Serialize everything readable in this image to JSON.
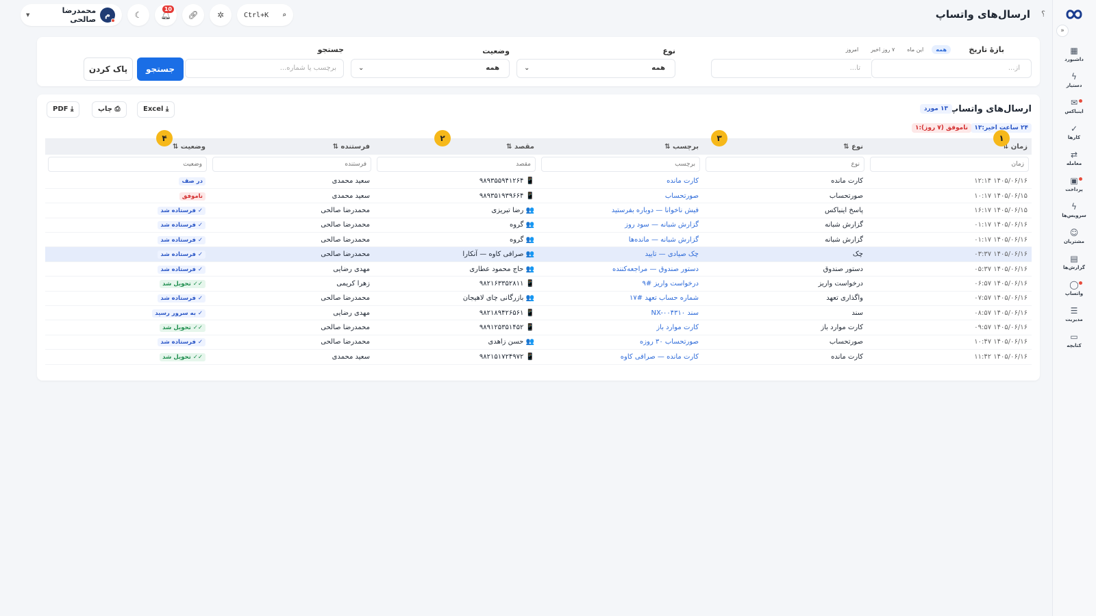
{
  "app": {
    "title": "ارسال‌های واتساپ",
    "help": "؟"
  },
  "colors": {
    "primary": "#1a6ee6",
    "accent_marker": "#f6b81a",
    "fail": "#d32f2f",
    "delivered": "#1e8e4e"
  },
  "sidebar": {
    "collapse": "«",
    "items": [
      {
        "label": "داشبورد",
        "icon": "dashboard-icon",
        "glyph": "▦"
      },
      {
        "label": "دستیار",
        "icon": "bolt-icon",
        "glyph": "ϟ"
      },
      {
        "label": "اینباکس",
        "icon": "inbox-icon",
        "glyph": "✉"
      },
      {
        "label": "کارها",
        "icon": "check-icon",
        "glyph": "✓"
      },
      {
        "label": "معامله",
        "icon": "swap-icon",
        "glyph": "⇄"
      },
      {
        "label": "پرداخت",
        "icon": "wallet-icon",
        "glyph": "▣"
      },
      {
        "label": "سرویس‌ها",
        "icon": "service-icon",
        "glyph": "ϟ"
      },
      {
        "label": "مشتریان",
        "icon": "users-icon",
        "glyph": "☺"
      },
      {
        "label": "گزارش‌ها",
        "icon": "report-icon",
        "glyph": "▤"
      },
      {
        "label": "واتساپ",
        "icon": "whatsapp-icon",
        "glyph": "◯"
      },
      {
        "label": "مدیریت",
        "icon": "settings-icon",
        "glyph": "☰"
      },
      {
        "label": "کتابچه",
        "icon": "book-icon",
        "glyph": "▭"
      }
    ]
  },
  "topbar": {
    "user_initial": "م",
    "user_name": "محمدرضا صالحی",
    "notifications": "10",
    "shortcut": "Ctrl+K"
  },
  "filters": {
    "date_label": "بازهٔ تاریخ",
    "quick": [
      "همه",
      "این ماه",
      "۷ روز اخیر",
      "امروز"
    ],
    "from_placeholder": "از...",
    "to_placeholder": "تا...",
    "type_label": "نوع",
    "type_value": "همه",
    "status_label": "وضعیت",
    "status_value": "همه",
    "search_label": "جستجو",
    "search_placeholder": "برچسب یا شماره...",
    "search_button": "جستجو",
    "clear_button": "پاک کردن"
  },
  "table": {
    "title": "ارسال‌های واتساپ",
    "count": "۱۳ مورد",
    "stat_recent": "۲۴ ساعت اخیر:۱۳",
    "stat_failed": "ناموفق (۷ روز):۱",
    "export": {
      "excel": "Excel",
      "print": "چاپ",
      "pdf": "PDF"
    },
    "columns": [
      "زمان ⇅",
      "نوع ⇅",
      "برچسب ⇅",
      "مقصد ⇅",
      "فرستنده ⇅",
      "وضعیت ⇅"
    ],
    "filter_placeholders": [
      "زمان",
      "نوع",
      "برچسب",
      "مقصد",
      "فرستنده",
      "وضعیت"
    ],
    "markers": [
      "۱",
      "۲",
      "۳",
      "۴"
    ],
    "rows": [
      {
        "time": "۱۴۰۵/۰۶/۱۶ ۱۲:۱۴",
        "type": "کارت مانده",
        "label": "کارت مانده",
        "dest": "📱 ۹۸۹۳۵۵۹۴۱۲۶۴",
        "sender": "سعید محمدی",
        "status": "در صف",
        "status_kind": "queue"
      },
      {
        "time": "۱۴۰۵/۰۶/۱۵ ۱۰:۱۷",
        "type": "صورتحساب",
        "label": "صورتحساب",
        "dest": "📱 ۹۸۹۳۵۱۹۳۹۶۶۴",
        "sender": "سعید محمدی",
        "status": "ناموفق",
        "status_kind": "fail"
      },
      {
        "time": "۱۴۰۵/۰۶/۱۵ ۱۶:۱۷",
        "type": "پاسخ اینباکس",
        "label": "فیش ناخوانا — دوباره بفرستید",
        "dest": "👥 رضا تبریزی",
        "sender": "محمدرضا صالحی",
        "status": "✓ فرستاده شد",
        "status_kind": "sent"
      },
      {
        "time": "۱۴۰۵/۰۶/۱۶ ۰۱:۱۷",
        "type": "گزارش شبانه",
        "label": "گزارش شبانه — سود روز",
        "dest": "👥 گروه",
        "sender": "محمدرضا صالحی",
        "status": "✓ فرستاده شد",
        "status_kind": "sent"
      },
      {
        "time": "۱۴۰۵/۰۶/۱۶ ۰۱:۱۷",
        "type": "گزارش شبانه",
        "label": "گزارش شبانه — مانده‌ها",
        "dest": "👥 گروه",
        "sender": "محمدرضا صالحی",
        "status": "✓ فرستاده شد",
        "status_kind": "sent"
      },
      {
        "time": "۱۴۰۵/۰۶/۱۶ ۰۳:۳۷",
        "type": "چک",
        "label": "چک صیادی — تایید",
        "dest": "👥 صرافی کاوه — آنکارا",
        "sender": "محمدرضا صالحی",
        "status": "✓ فرستاده شد",
        "status_kind": "sent",
        "selected": true
      },
      {
        "time": "۱۴۰۵/۰۶/۱۶ ۰۵:۳۷",
        "type": "دستور صندوق",
        "label": "دستور صندوق — مراجعه‌کننده",
        "dest": "👥 حاج محمود عطاری",
        "sender": "مهدی رضایی",
        "status": "✓ فرستاده شد",
        "status_kind": "sent"
      },
      {
        "time": "۱۴۰۵/۰۶/۱۶ ۰۶:۵۷",
        "type": "درخواست واریز",
        "label": "درخواست واریز #۹",
        "dest": "📱 ۹۸۲۱۶۳۳۵۲۸۱۱",
        "sender": "زهرا کریمی",
        "status": "✓✓ تحویل شد",
        "status_kind": "deliv"
      },
      {
        "time": "۱۴۰۵/۰۶/۱۶ ۰۷:۵۷",
        "type": "واگذاری تعهد",
        "label": "شماره حساب تعهد #۱۷",
        "dest": "👥 بازرگانی چای لاهیجان",
        "sender": "محمدرضا صالحی",
        "status": "✓ فرستاده شد",
        "status_kind": "sent"
      },
      {
        "time": "۱۴۰۵/۰۶/۱۶ ۰۸:۵۷",
        "type": "سند",
        "label": "سند NX-۰۰۴۳۱۰",
        "dest": "📱 ۹۸۲۱۸۹۴۲۶۵۶۱",
        "sender": "مهدی رضایی",
        "status": "✓ به سرور رسید",
        "status_kind": "sent"
      },
      {
        "time": "۱۴۰۵/۰۶/۱۶ ۰۹:۵۷",
        "type": "کارت موارد باز",
        "label": "کارت موارد باز",
        "dest": "📱 ۹۸۹۱۲۵۳۵۱۴۵۲",
        "sender": "محمدرضا صالحی",
        "status": "✓✓ تحویل شد",
        "status_kind": "deliv"
      },
      {
        "time": "۱۴۰۵/۰۶/۱۶ ۱۰:۴۷",
        "type": "صورتحساب",
        "label": "صورتحساب ۳۰ روزه",
        "dest": "👥 حسن زاهدی",
        "sender": "محمدرضا صالحی",
        "status": "✓ فرستاده شد",
        "status_kind": "sent"
      },
      {
        "time": "۱۴۰۵/۰۶/۱۶ ۱۱:۴۲",
        "type": "کارت مانده",
        "label": "کارت مانده — صرافی کاوه",
        "dest": "📱 ۹۸۲۱۵۱۷۲۴۹۷۲",
        "sender": "سعید محمدی",
        "status": "✓✓ تحویل شد",
        "status_kind": "deliv"
      }
    ]
  }
}
